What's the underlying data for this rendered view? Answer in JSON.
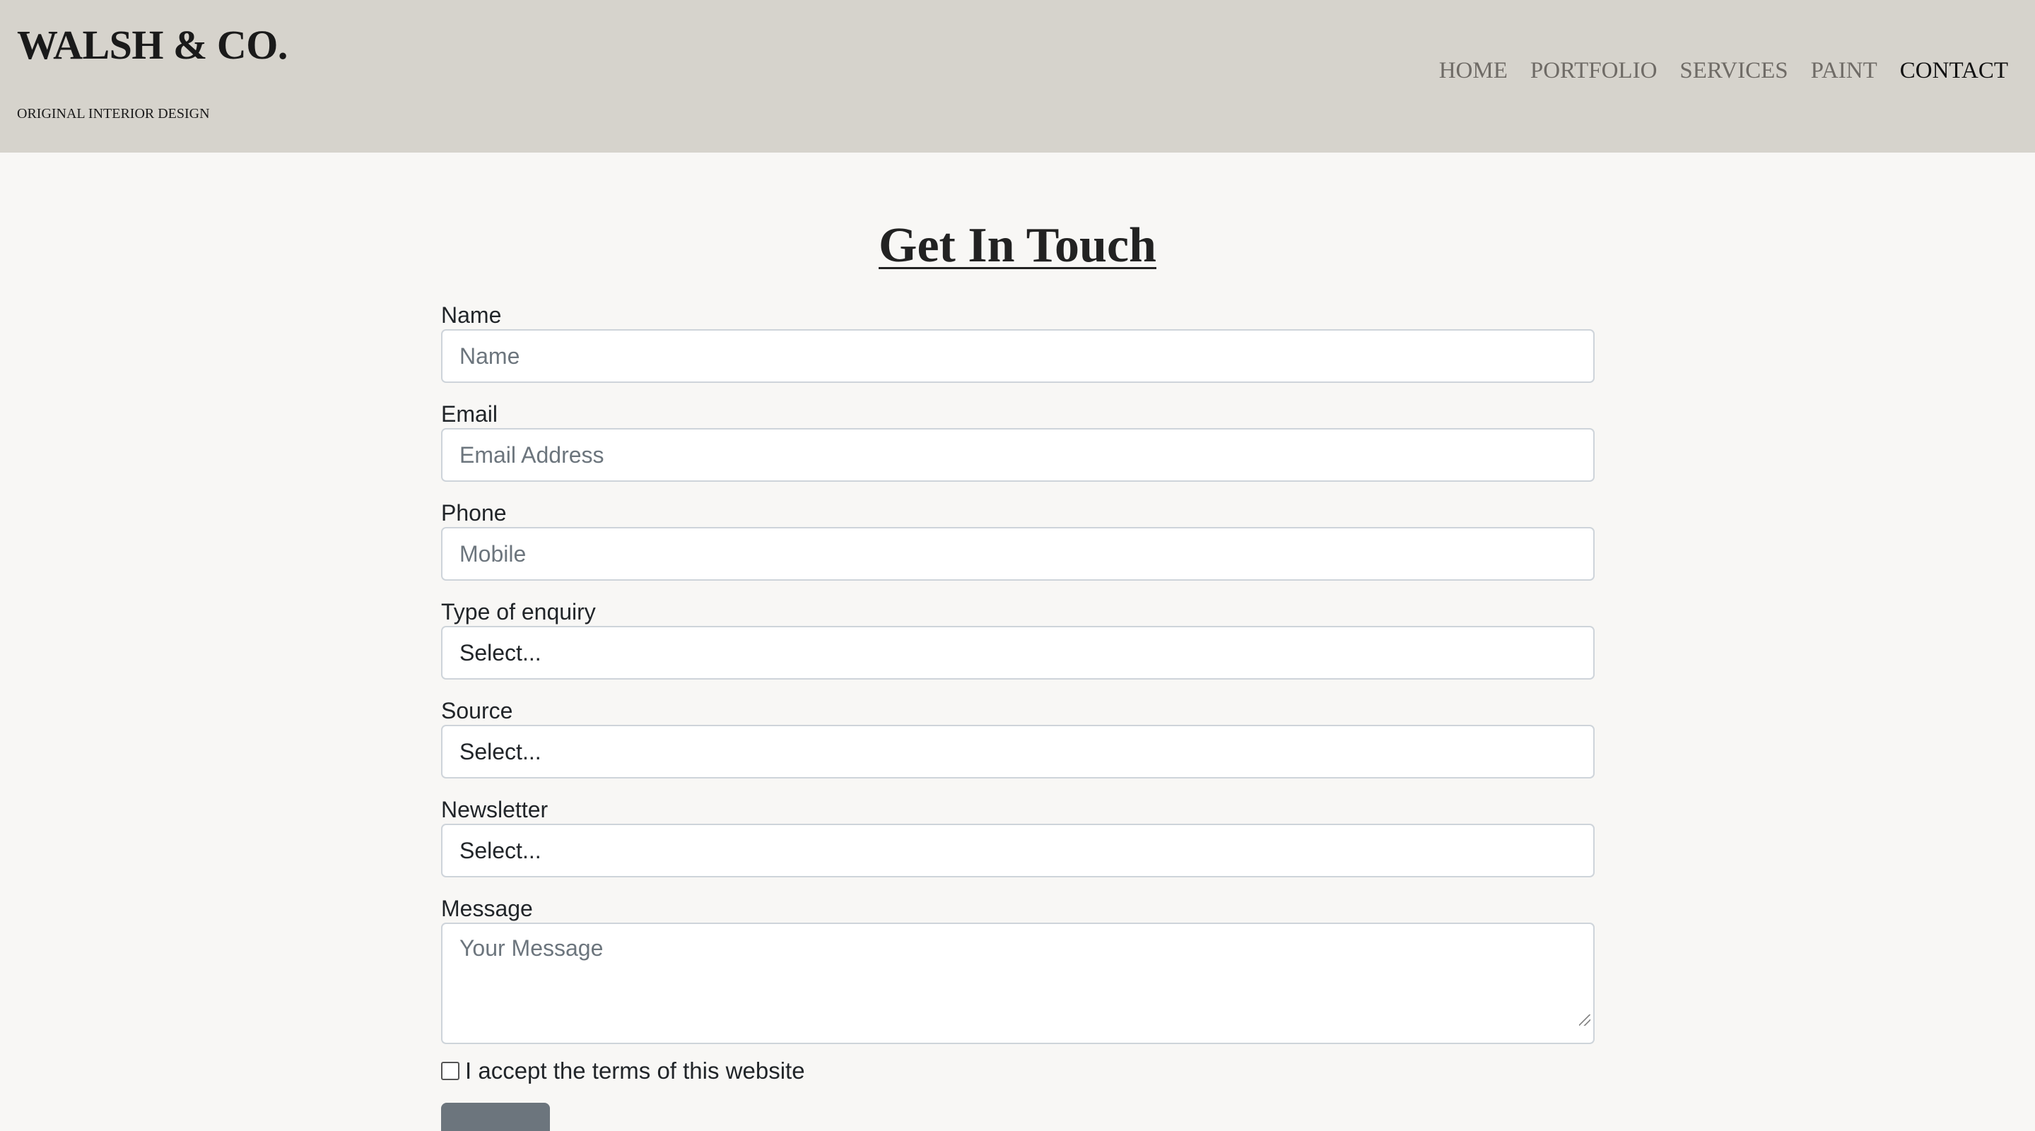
{
  "header": {
    "brand": "WALSH & CO.",
    "tagline": "ORIGINAL INTERIOR DESIGN",
    "nav": [
      {
        "label": "HOME",
        "active": false
      },
      {
        "label": "PORTFOLIO",
        "active": false
      },
      {
        "label": "SERVICES",
        "active": false
      },
      {
        "label": "PAINT",
        "active": false
      },
      {
        "label": "CONTACT",
        "active": true
      }
    ]
  },
  "page": {
    "title": "Get In Touch"
  },
  "form": {
    "name": {
      "label": "Name",
      "placeholder": "Name",
      "value": ""
    },
    "email": {
      "label": "Email",
      "placeholder": "Email Address",
      "value": ""
    },
    "phone": {
      "label": "Phone",
      "placeholder": "Mobile",
      "value": ""
    },
    "enquiry": {
      "label": "Type of enquiry",
      "selected": "Select..."
    },
    "source": {
      "label": "Source",
      "selected": "Select..."
    },
    "newsletter": {
      "label": "Newsletter",
      "selected": "Select..."
    },
    "message": {
      "label": "Message",
      "placeholder": "Your Message",
      "value": ""
    },
    "terms": {
      "label": "I accept the terms of this website",
      "checked": false
    }
  },
  "colors": {
    "header_bg": "#d6d3cc",
    "page_bg": "#f8f7f5",
    "nav_inactive": "#6f6b66",
    "nav_active": "#111111",
    "submit_bg": "#6c757d"
  }
}
